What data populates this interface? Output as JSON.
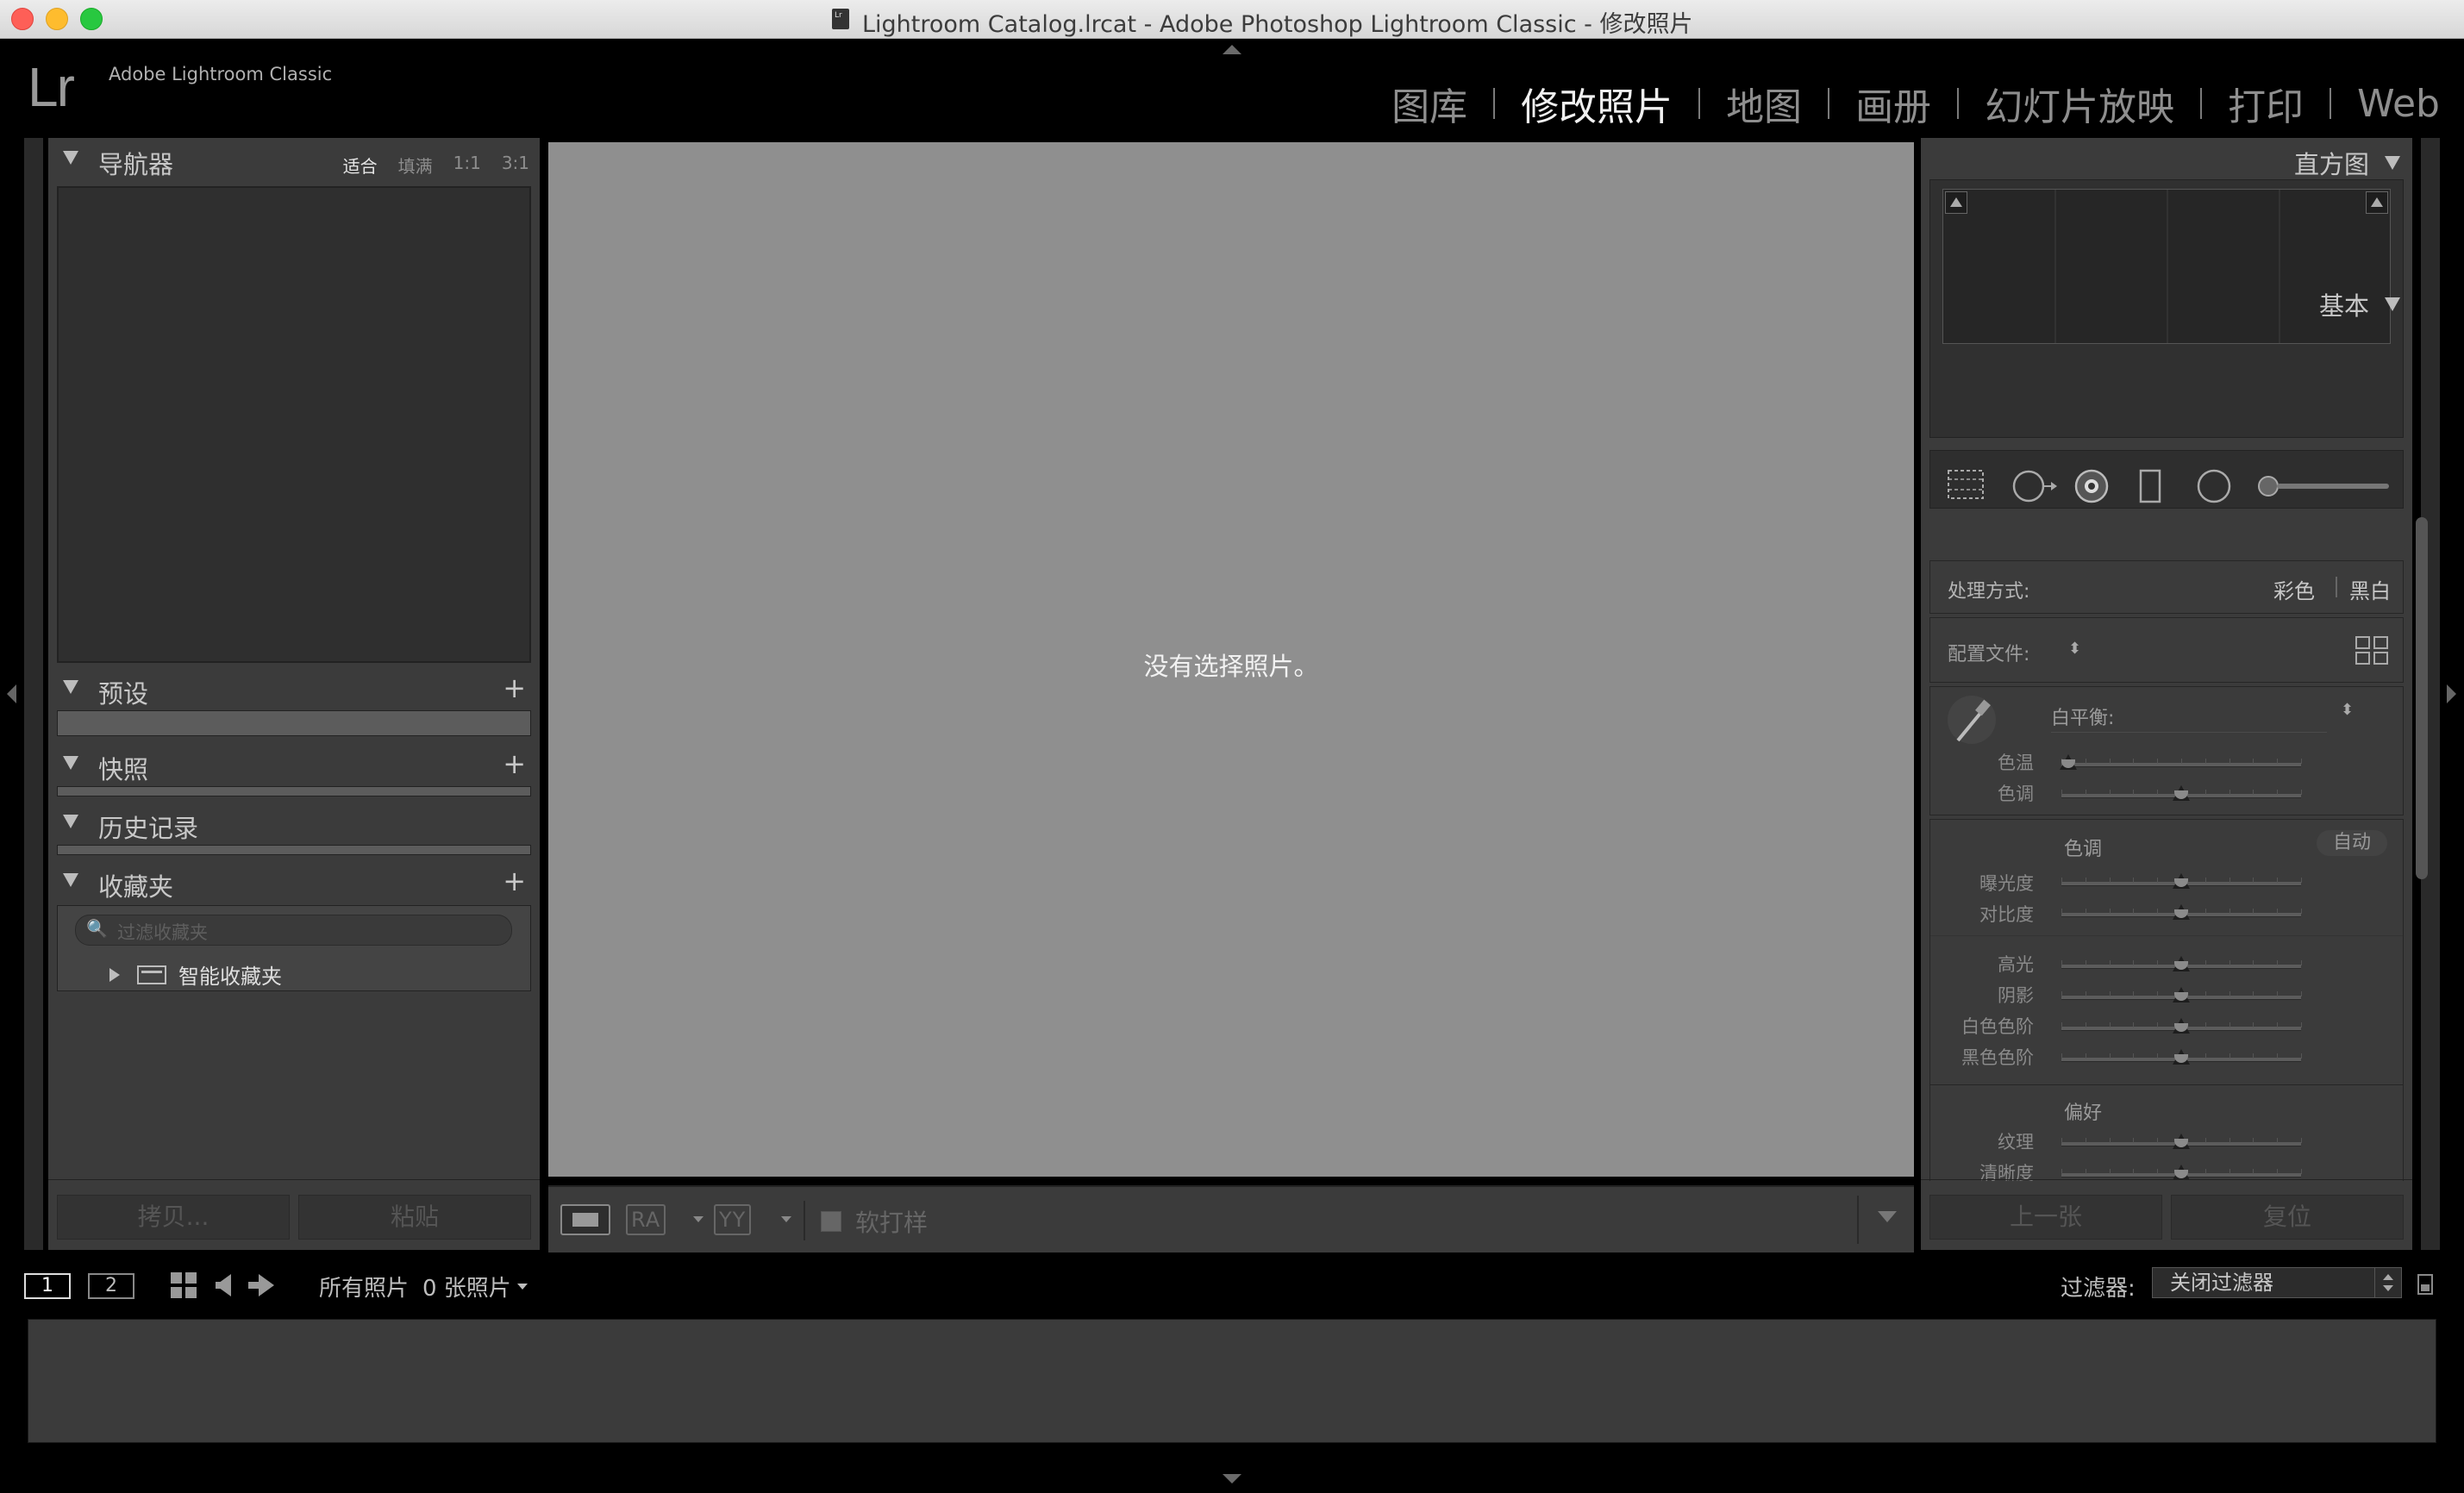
{
  "window": {
    "title": "Lightroom Catalog.lrcat - Adobe Photoshop Lightroom Classic - 修改照片"
  },
  "app": {
    "logo": "Lr",
    "name": "Adobe Lightroom Classic"
  },
  "modules": [
    {
      "label": "图库",
      "active": false
    },
    {
      "label": "修改照片",
      "active": true
    },
    {
      "label": "地图",
      "active": false
    },
    {
      "label": "画册",
      "active": false
    },
    {
      "label": "幻灯片放映",
      "active": false
    },
    {
      "label": "打印",
      "active": false
    },
    {
      "label": "Web",
      "active": false
    }
  ],
  "left_panel": {
    "navigator": {
      "title": "导航器",
      "zoom_options": [
        "适合",
        "填满",
        "1:1",
        "3:1"
      ],
      "selected_zoom": "适合"
    },
    "presets": {
      "title": "预设",
      "add": "+"
    },
    "snapshots": {
      "title": "快照",
      "add": "+"
    },
    "history": {
      "title": "历史记录"
    },
    "collections": {
      "title": "收藏夹",
      "add": "+",
      "search_placeholder": "过滤收藏夹",
      "items": [
        {
          "label": "智能收藏夹"
        }
      ]
    },
    "copy_button": "拷贝...",
    "paste_button": "粘贴"
  },
  "center": {
    "message": "没有选择照片。",
    "toolbar": {
      "compare_label": "RA",
      "survey_label": "YY",
      "soft_proof_label": "软打样"
    }
  },
  "right_panel": {
    "histogram": {
      "title": "直方图"
    },
    "basic": {
      "title": "基本",
      "treatment_label": "处理方式:",
      "treatment_color": "彩色",
      "treatment_bw": "黑白",
      "profile_label": "配置文件:",
      "wb_label": "白平衡:",
      "sliders_wb": [
        {
          "label": "色温",
          "value": 0.03
        },
        {
          "label": "色调",
          "value": 0.5
        }
      ],
      "tone_title": "色调",
      "auto_label": "自动",
      "sliders_tone": [
        {
          "label": "曝光度",
          "value": 0.5
        },
        {
          "label": "对比度",
          "value": 0.5
        }
      ],
      "sliders_tone2": [
        {
          "label": "高光",
          "value": 0.5
        },
        {
          "label": "阴影",
          "value": 0.5
        },
        {
          "label": "白色色阶",
          "value": 0.5
        },
        {
          "label": "黑色色阶",
          "value": 0.5
        }
      ],
      "presence_title": "偏好",
      "sliders_presence": [
        {
          "label": "纹理",
          "value": 0.5
        },
        {
          "label": "清晰度",
          "value": 0.5
        }
      ]
    },
    "previous_button": "上一张",
    "reset_button": "复位"
  },
  "filmstrip": {
    "page1": "1",
    "page2": "2",
    "source": "所有照片",
    "count": "0 张照片",
    "filter_label": "过滤器:",
    "filter_value": "关闭过滤器"
  }
}
